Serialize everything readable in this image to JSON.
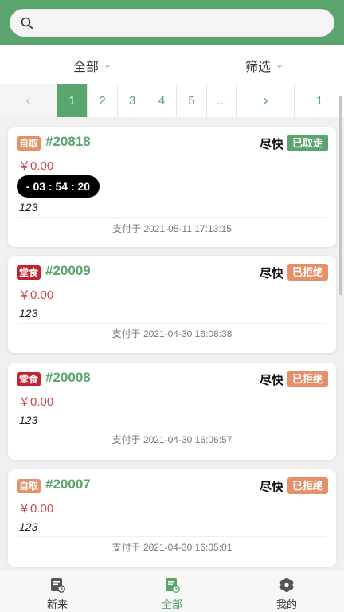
{
  "search": {
    "placeholder": ""
  },
  "filters": {
    "all_label": "全部",
    "filter_label": "筛选"
  },
  "pager": {
    "prev": "‹",
    "pages": [
      "1",
      "2",
      "3",
      "4",
      "5"
    ],
    "ellipsis": "...",
    "next": "›",
    "last": "1",
    "active": "1"
  },
  "orders": [
    {
      "type": "自取",
      "type_kind": "pickup",
      "number": "#20818",
      "asap": "尽快",
      "status": "已取走",
      "status_kind": "taken",
      "price": "￥0.00",
      "timer": "- 03 : 54 : 20",
      "note": "123",
      "paid": "支付于 2021-05-11 17:13:15"
    },
    {
      "type": "堂食",
      "type_kind": "dinein",
      "number": "#20009",
      "asap": "尽快",
      "status": "已拒绝",
      "status_kind": "rejected",
      "price": "￥0.00",
      "note": "123",
      "paid": "支付于 2021-04-30 16:08:38"
    },
    {
      "type": "堂食",
      "type_kind": "dinein",
      "number": "#20008",
      "asap": "尽快",
      "status": "已拒绝",
      "status_kind": "rejected",
      "price": "￥0.00",
      "note": "123",
      "paid": "支付于 2021-04-30 16:06:57"
    },
    {
      "type": "自取",
      "type_kind": "pickup",
      "number": "#20007",
      "asap": "尽快",
      "status": "已拒绝",
      "status_kind": "rejected",
      "price": "￥0.00",
      "note": "123",
      "paid": "支付于 2021-04-30 16:05:01"
    }
  ],
  "tabs": [
    {
      "label": "新来",
      "icon": "new-orders-icon"
    },
    {
      "label": "全部",
      "icon": "all-orders-icon"
    },
    {
      "label": "我的",
      "icon": "gear-icon"
    }
  ],
  "colors": {
    "brand": "#5aa46d",
    "pickup": "#e6906a",
    "dinein": "#c4222e",
    "price": "#c9494f"
  }
}
